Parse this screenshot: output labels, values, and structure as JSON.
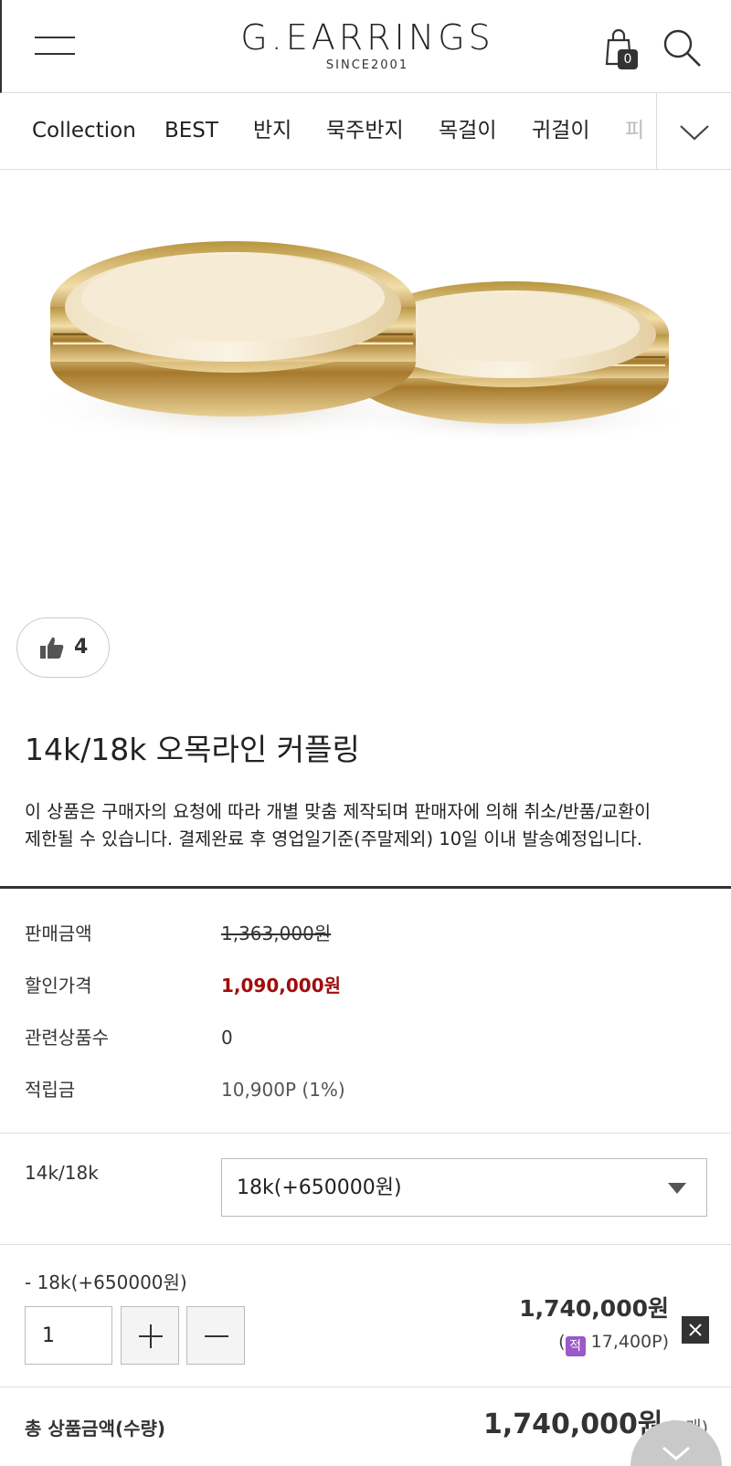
{
  "header": {
    "logo_main": "G.EARRINGS",
    "logo_sub": "SINCE2001",
    "cart_count": "0",
    "icons": [
      "menu-icon",
      "cart-icon",
      "search-icon"
    ]
  },
  "nav": {
    "items": [
      "Collection",
      "BEST",
      "반지",
      "묵주반지",
      "목걸이",
      "귀걸이",
      "피"
    ]
  },
  "product": {
    "like_count": "4",
    "title": "14k/18k 오목라인 커플링",
    "notice_line1": "이 상품은 구매자의 요청에 따라 개별 맞춤 제작되며 판매자에 의해 취소/반품/교환이",
    "notice_line2": "제한될 수 있습니다. 결제완료 후 영업일기준(주말제외) 10일 이내 발송예정입니다."
  },
  "info": {
    "price_label": "판매금액",
    "price_value": "1,363,000원",
    "discount_label": "할인가격",
    "discount_value": "1,090,000원",
    "related_label": "관련상품수",
    "related_value": "0",
    "points_label": "적립금",
    "points_value": "10,900P (1%)"
  },
  "option": {
    "label": "14k/18k",
    "selected": "18k(+650000원)"
  },
  "selection": {
    "name": "- 18k(+650000원)",
    "quantity": "1",
    "price": "1,740,000원",
    "point_prefix": "(",
    "point_badge": "적",
    "point_value": "17,400P)"
  },
  "total": {
    "label": "총 상품금액(수량)",
    "amount": "1,740,000원",
    "count": "(1개)"
  },
  "colors": {
    "accent_discount": "#a10c0c",
    "point_badge": "#9b59c9",
    "text": "#222222"
  }
}
